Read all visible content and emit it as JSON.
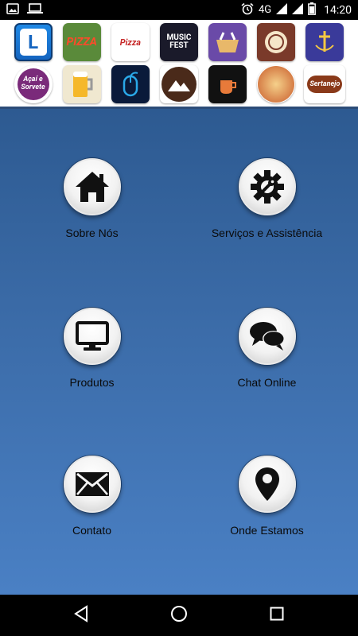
{
  "status_bar": {
    "network": "4G",
    "time": "14:20",
    "icons": [
      "image-icon",
      "laptop-icon",
      "alarm-icon",
      "signal-icon",
      "signal-icon",
      "battery-icon"
    ]
  },
  "banner": {
    "apps": [
      {
        "name": "app-icon-l",
        "label": "L"
      },
      {
        "name": "app-icon-pizza",
        "label": "PIZZA"
      },
      {
        "name": "app-icon-chef-pizza",
        "label": "Pizza"
      },
      {
        "name": "app-icon-music-fest",
        "label": "MUSIC FEST"
      },
      {
        "name": "app-icon-basket",
        "label": ""
      },
      {
        "name": "app-icon-plate",
        "label": ""
      },
      {
        "name": "app-icon-church",
        "label": ""
      },
      {
        "name": "app-icon-acai",
        "label": "Açaí e Sorvete"
      },
      {
        "name": "app-icon-beer",
        "label": ""
      },
      {
        "name": "app-icon-mouse",
        "label": ""
      },
      {
        "name": "app-icon-mountain",
        "label": ""
      },
      {
        "name": "app-icon-cafe",
        "label": ""
      },
      {
        "name": "app-icon-food",
        "label": ""
      },
      {
        "name": "app-icon-sertanejo",
        "label": "Sertanejo"
      }
    ]
  },
  "menu": {
    "items": [
      {
        "label": "Sobre Nós",
        "icon": "home-icon"
      },
      {
        "label": "Serviços e Assistência",
        "icon": "gear-wrench-icon"
      },
      {
        "label": "Produtos",
        "icon": "monitor-icon"
      },
      {
        "label": "Chat Online",
        "icon": "chat-bubbles-icon"
      },
      {
        "label": "Contato",
        "icon": "envelope-icon"
      },
      {
        "label": "Onde Estamos",
        "icon": "map-pin-icon"
      }
    ]
  },
  "colors": {
    "main_top": "#2d5a91",
    "main_bottom": "#4a80c4",
    "banner_border": "#2c4c78"
  },
  "nav": {
    "buttons": [
      "back-icon",
      "home-circle-icon",
      "recents-icon"
    ]
  }
}
